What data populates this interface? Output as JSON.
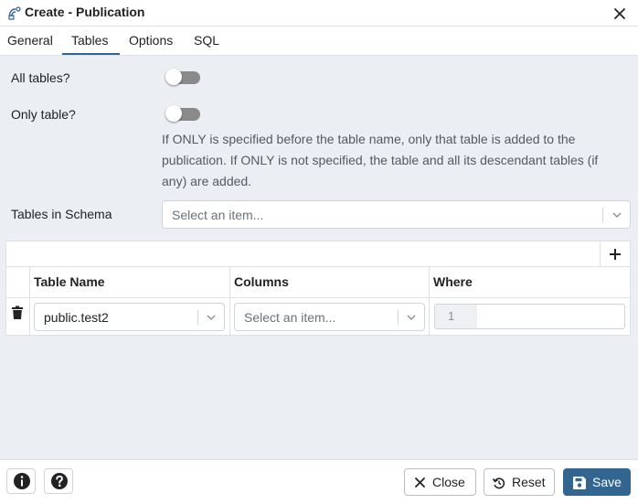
{
  "dialog": {
    "title": "Create - Publication",
    "icon": "publication-icon",
    "close_icon": "close-icon"
  },
  "tabs": [
    {
      "label": "General",
      "active": false
    },
    {
      "label": "Tables",
      "active": true
    },
    {
      "label": "Options",
      "active": false
    },
    {
      "label": "SQL",
      "active": false
    }
  ],
  "form": {
    "all_tables": {
      "label": "All tables?",
      "value": false
    },
    "only_table": {
      "label": "Only table?",
      "value": false
    },
    "help_text": "If ONLY is specified before the table name, only that table is added to the publication. If ONLY is not specified, the table and all its descendant tables (if any) are added.",
    "tables_in_schema": {
      "label": "Tables in Schema",
      "placeholder": "Select an item..."
    }
  },
  "grid": {
    "add_icon": "plus-icon",
    "columns": [
      "Table Name",
      "Columns",
      "Where"
    ],
    "rows": [
      {
        "table_name": "public.test2",
        "columns_placeholder": "Select an item...",
        "where_line_number": "1",
        "where_value": ""
      }
    ],
    "delete_icon": "trash-icon"
  },
  "footer": {
    "info_icon": "info-icon",
    "help_icon": "help-icon",
    "close_label": "Close",
    "reset_label": "Reset",
    "save_label": "Save"
  },
  "colors": {
    "primary": "#326690",
    "content_bg": "#ebeef3",
    "toggle_off": "#8a8a8a"
  }
}
